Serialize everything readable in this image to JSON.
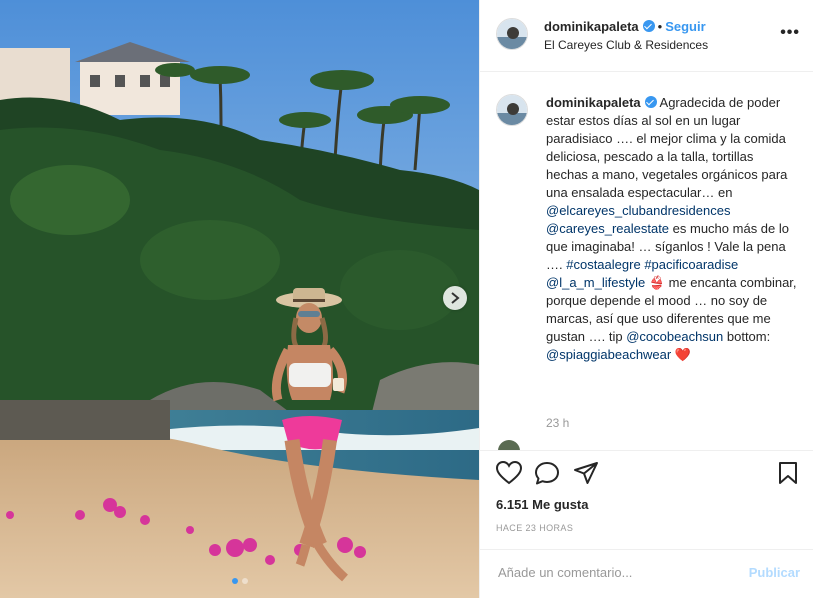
{
  "post": {
    "username": "dominikapaleta",
    "separator": "•",
    "follow_label": "Seguir",
    "location": "El Careyes Club & Residences",
    "more_icon": "more-options-icon",
    "caption": {
      "t1": " Agradecida de poder estar estos días al sol en un lugar paradisiaco …. el mejor clima y la comida deliciosa, pescado a la talla, tortillas hechas a mano, vegetales orgánicos para una ensalada espectacular… en ",
      "m1": "@elcareyes_clubandresidences",
      "m2": "@careyes_realestate",
      "t2": " es mucho más de lo que imaginaba! … síganlos ! Vale la pena …. ",
      "h1": "#costaalegre",
      "h2": "#pacificoaradise",
      "m3": "@l_a_m_lifestyle",
      "emoji1": "👙",
      "t3": " me encanta combinar, porque depende el mood … no soy de marcas, así que uso diferentes que me gustan …. tip ",
      "m4": "@cocobeachsun",
      "t4": " bottom: ",
      "m5": "@spiaggiabeachwear",
      "emoji2": "❤️"
    },
    "time": "23 h",
    "likes": "6.151 Me gusta",
    "time_ago": "HACE 23 HORAS",
    "comment_placeholder": "Añade un comentario...",
    "publish_label": "Publicar",
    "colors": {
      "link": "#3897f0",
      "mention": "#003569",
      "publish_disabled": "#b3dbff",
      "heart": "#ed4956"
    }
  }
}
